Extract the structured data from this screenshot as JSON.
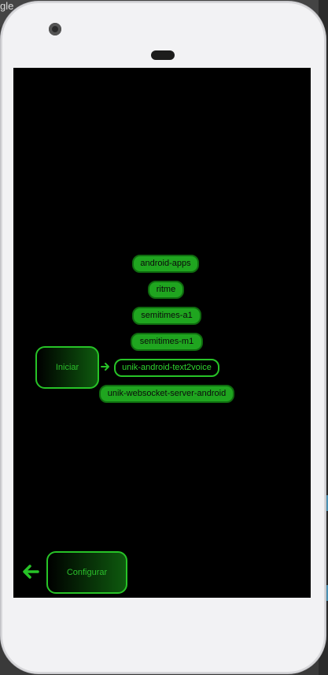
{
  "browser": {
    "partial_title": "gle"
  },
  "app": {
    "items": [
      {
        "label": "android-apps",
        "selected": false
      },
      {
        "label": "ritme",
        "selected": false
      },
      {
        "label": "semitimes-a1",
        "selected": false
      },
      {
        "label": "semitimes-m1",
        "selected": false
      },
      {
        "label": "unik-android-text2voice",
        "selected": true
      },
      {
        "label": "unik-websocket-server-android",
        "selected": false
      }
    ],
    "start_button_label": "Iniciar",
    "configure_button_label": "Configurar",
    "accent_color": "#27c327",
    "item_fill_color": "#1fa51f"
  },
  "icons": {
    "selection_indicator": "arrow-right-icon",
    "back": "arrow-left-icon"
  }
}
